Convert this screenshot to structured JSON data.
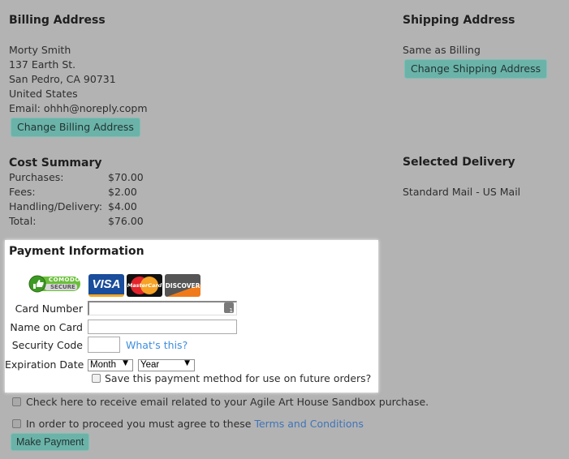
{
  "billing": {
    "heading": "Billing Address",
    "name": "Morty Smith",
    "street": "137 Earth St.",
    "city_line": "San Pedro, CA 90731",
    "country": "United States",
    "email_line": "Email: ohhh@noreply.copm",
    "change_button": "Change Billing Address"
  },
  "shipping": {
    "heading": "Shipping Address",
    "value": "Same as Billing",
    "change_button": "Change Shipping Address"
  },
  "cost_summary": {
    "heading": "Cost Summary",
    "rows": [
      {
        "label": "Purchases:",
        "value": "$70.00"
      },
      {
        "label": "Fees:",
        "value": "$2.00"
      },
      {
        "label": "Handling/Delivery:",
        "value": "$4.00"
      },
      {
        "label": "Total:",
        "value": "$76.00"
      }
    ]
  },
  "delivery": {
    "heading": "Selected Delivery",
    "value": "Standard Mail - US Mail"
  },
  "payment": {
    "heading": "Payment Information",
    "badges": {
      "comodo_top": "COMODO",
      "comodo_bottom": "SECURE",
      "visa": "VISA",
      "mastercard": "MasterCard",
      "discover": "DISCOVER"
    },
    "card_number_label": "Card Number",
    "card_number_value": "",
    "name_on_card_label": "Name on Card",
    "name_on_card_value": "",
    "security_code_label": "Security Code",
    "security_code_value": "",
    "whats_this_link": "What's this?",
    "expiration_label": "Expiration Date",
    "month_selected": "Month",
    "year_selected": "Year",
    "save_method_label": "Save this payment method for use on future orders?",
    "save_method_checked": false
  },
  "email_opt_in": {
    "label": "Check here to receive email related to your Agile Art House Sandbox purchase.",
    "checked": false
  },
  "terms": {
    "label": "In order to proceed you must agree to these ",
    "link": "Terms and Conditions",
    "checked": false
  },
  "make_payment_button": "Make Payment",
  "colors": {
    "overlay_background": "#b3b3b3",
    "button_teal": "#6bb3a8",
    "link_blue": "#3e8ede"
  }
}
